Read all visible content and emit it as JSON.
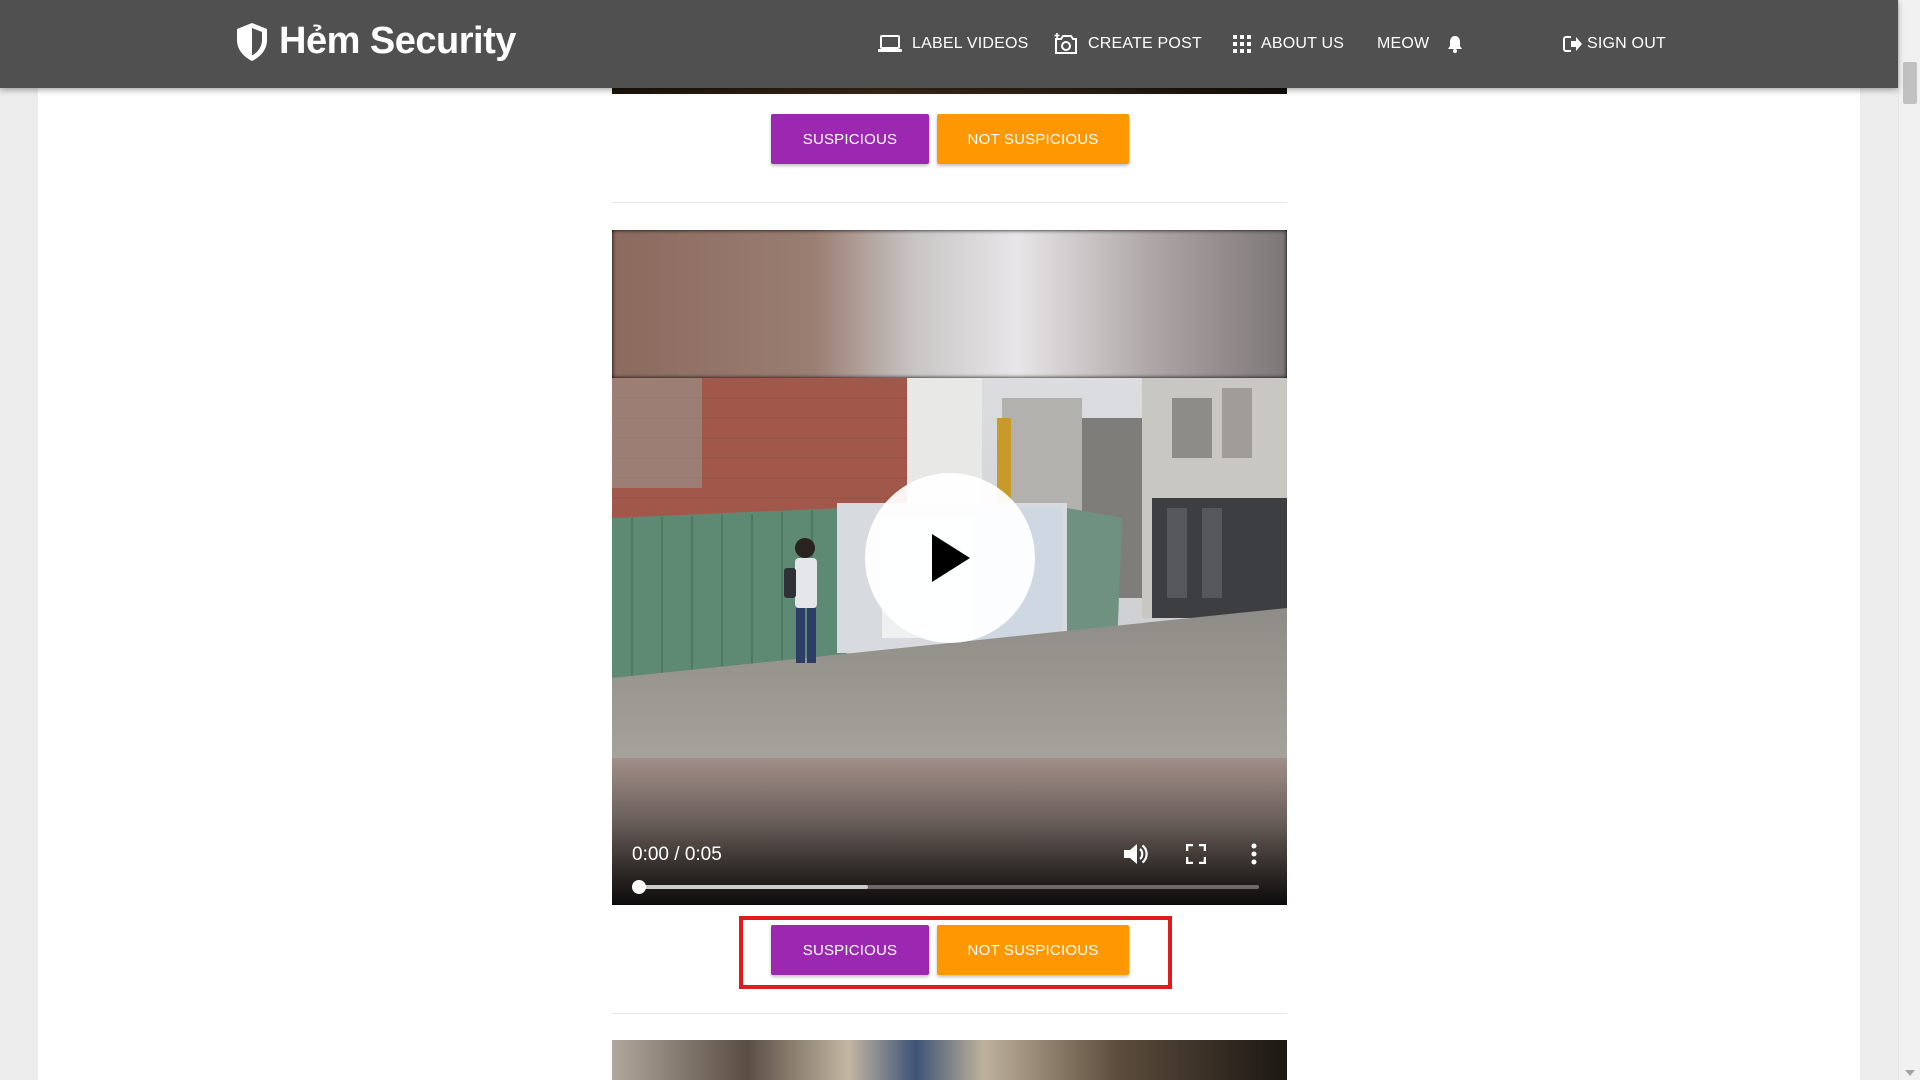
{
  "navbar": {
    "brand": "Hẻm Security",
    "items": [
      {
        "label": "LABEL VIDEOS",
        "icon": "laptop-icon"
      },
      {
        "label": "CREATE POST",
        "icon": "camera-plus-icon"
      },
      {
        "label": "ABOUT US",
        "icon": "apps-grid-icon"
      },
      {
        "label": "MEOW",
        "icon": "bell-icon"
      },
      {
        "label": "SIGN OUT",
        "icon": "sign-out-icon"
      }
    ]
  },
  "posts": [
    {
      "buttons": {
        "suspicious": "SUSPICIOUS",
        "not_suspicious": "NOT SUSPICIOUS"
      }
    },
    {
      "video": {
        "time": "0:00 / 0:05",
        "played_fraction": 0.0,
        "buffered_fraction": 0.37
      },
      "buttons": {
        "suspicious": "SUSPICIOUS",
        "not_suspicious": "NOT SUSPICIOUS"
      },
      "highlighted": true
    }
  ],
  "colors": {
    "navbar": "#505050",
    "suspicious": "#9c27b0",
    "not_suspicious": "#ff9800",
    "highlight": "#e01b1b"
  }
}
